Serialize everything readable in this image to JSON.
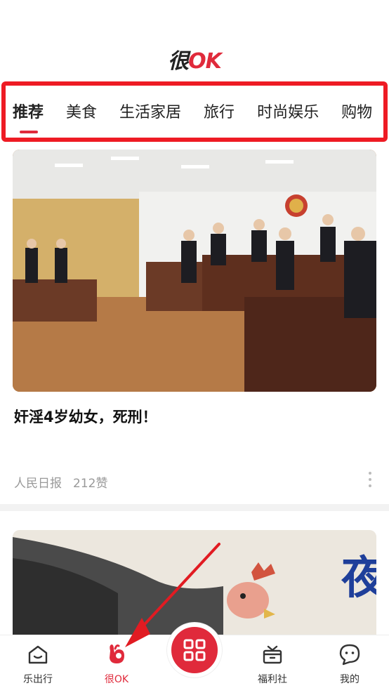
{
  "header": {
    "logo_part1": "很",
    "logo_part2": "OK"
  },
  "tabs": [
    {
      "label": "推荐",
      "active": true
    },
    {
      "label": "美食"
    },
    {
      "label": "生活家居"
    },
    {
      "label": "旅行"
    },
    {
      "label": "时尚娱乐"
    },
    {
      "label": "购物"
    }
  ],
  "feed": [
    {
      "title": "奸淫4岁幼女，死刑！",
      "source": "人民日报",
      "likes": "212赞"
    },
    {
      "title": "",
      "source": "",
      "likes": ""
    }
  ],
  "bottom_nav": [
    {
      "label": "乐出行",
      "icon": "home-smile-icon"
    },
    {
      "label": "很OK",
      "icon": "ok-hand-icon",
      "active": true
    },
    {
      "label": "",
      "icon": "scan-icon"
    },
    {
      "label": "福利社",
      "icon": "gift-icon"
    },
    {
      "label": "我的",
      "icon": "face-icon"
    }
  ],
  "colors": {
    "accent": "#e02a3b",
    "highlight_box": "#ee1b24"
  }
}
